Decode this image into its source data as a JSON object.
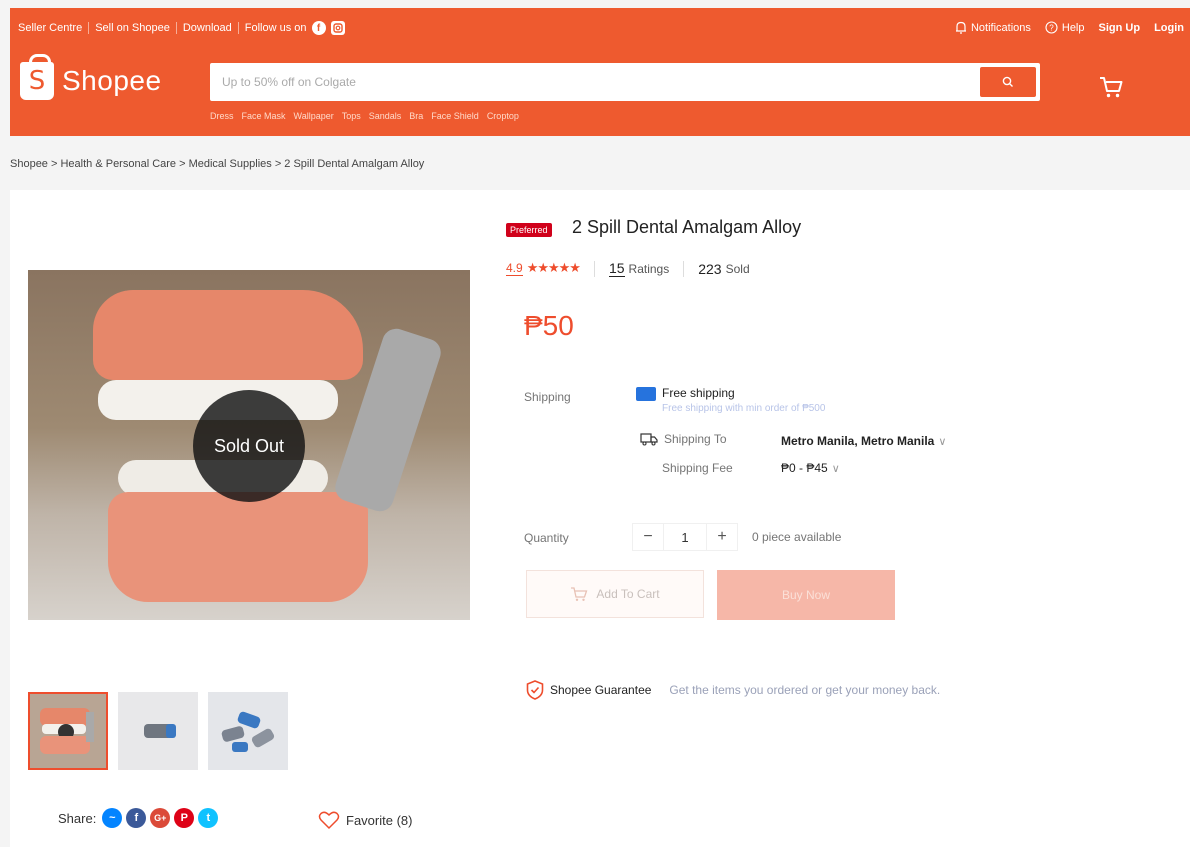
{
  "topbar": {
    "links": [
      "Seller Centre",
      "Sell on Shopee",
      "Download",
      "Follow us on"
    ],
    "social_icons": [
      "facebook-icon",
      "instagram-icon"
    ],
    "notifications": "Notifications",
    "help": "Help",
    "signup": "Sign Up",
    "login": "Login"
  },
  "header": {
    "logo_text": "Shopee",
    "search_placeholder": "Up to 50% off on Colgate",
    "keywords": [
      "Dress",
      "Face Mask",
      "Wallpaper",
      "Tops",
      "Sandals",
      "Bra",
      "Face Shield",
      "Croptop"
    ]
  },
  "breadcrumb": [
    "Shopee",
    "Health & Personal Care",
    "Medical Supplies",
    "2 Spill Dental Amalgam Alloy"
  ],
  "breadcrumb_sep": ">",
  "gallery": {
    "overlay": "Sold Out",
    "thumbnails": 3,
    "selected_thumbnail": 0
  },
  "share": {
    "label": "Share:",
    "icons": [
      "messenger-icon",
      "facebook-icon",
      "google-plus-icon",
      "pinterest-icon",
      "twitter-icon"
    ]
  },
  "favorite": {
    "label": "Favorite (8)"
  },
  "product": {
    "badge": "Preferred",
    "title": "2 Spill Dental Amalgam Alloy",
    "rating": "4.9",
    "stars": 5,
    "ratings_count": "15",
    "ratings_label": "Ratings",
    "sold_count": "223",
    "sold_label": "Sold",
    "price": "₱50"
  },
  "shipping": {
    "label": "Shipping",
    "free_title": "Free shipping",
    "free_sub": "Free shipping with min order of ₱500",
    "to_label": "Shipping To",
    "to_value": "Metro Manila, Metro Manila",
    "fee_label": "Shipping Fee",
    "fee_value": "₱0 - ₱45"
  },
  "quantity": {
    "label": "Quantity",
    "minus": "−",
    "value": "1",
    "plus": "+",
    "available": "0 piece available"
  },
  "actions": {
    "add_to_cart": "Add To Cart",
    "buy_now": "Buy Now"
  },
  "guarantee": {
    "title": "Shopee Guarantee",
    "text": "Get the items you ordered or get your money back."
  },
  "colors": {
    "brand": "#ee5a2f",
    "accent": "#ee4d2d"
  }
}
